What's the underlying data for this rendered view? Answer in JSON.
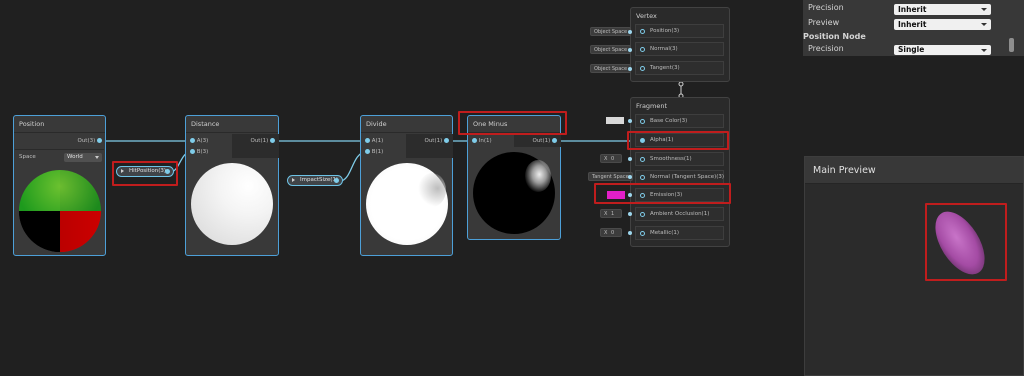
{
  "inspector": {
    "precision_label": "Precision",
    "precision_value": "Inherit",
    "preview_label": "Preview",
    "preview_value": "Inherit",
    "position_node_heading": "Position Node",
    "pn_precision_label": "Precision",
    "pn_precision_value": "Single"
  },
  "position_node": {
    "title": "Position",
    "out_label": "Out(3)",
    "space_label": "Space",
    "space_value": "World"
  },
  "hit_position": {
    "label": "HitPosition(3)"
  },
  "distance_node": {
    "title": "Distance",
    "in_a": "A(3)",
    "in_b": "B(3)",
    "out": "Out(1)"
  },
  "impact_size": {
    "label": "ImpactSize(1)"
  },
  "divide_node": {
    "title": "Divide",
    "in_a": "A(1)",
    "in_b": "B(1)",
    "out": "Out(1)"
  },
  "one_minus_node": {
    "title": "One Minus",
    "in": "In(1)",
    "out": "Out(1)"
  },
  "vertex_block": {
    "title": "Vertex",
    "slots": [
      {
        "tag": "Object Space",
        "label": "Position(3)"
      },
      {
        "tag": "Object Space",
        "label": "Normal(3)"
      },
      {
        "tag": "Object Space",
        "label": "Tangent(3)"
      }
    ]
  },
  "fragment_block": {
    "title": "Fragment",
    "slots": [
      {
        "label": "Base Color(3)"
      },
      {
        "label": "Alpha(1)"
      },
      {
        "tag_x": "X",
        "tag_val": "0",
        "label": "Smoothness(1)"
      },
      {
        "tag": "Tangent Space",
        "label": "Normal (Tangent Space)(3)"
      },
      {
        "label": "Emission(3)"
      },
      {
        "tag_x": "X",
        "tag_val": "1",
        "label": "Ambient Occlusion(1)"
      },
      {
        "tag_x": "X",
        "tag_val": "0",
        "label": "Metallic(1)"
      }
    ]
  },
  "main_preview": {
    "title": "Main Preview"
  },
  "colors": {
    "background": "#202020",
    "node": "#393939",
    "selection": "#4da0d8",
    "highlight": "#c01d1d",
    "emission_swatch": "#e21fc8",
    "wire": "#7fcce9"
  }
}
